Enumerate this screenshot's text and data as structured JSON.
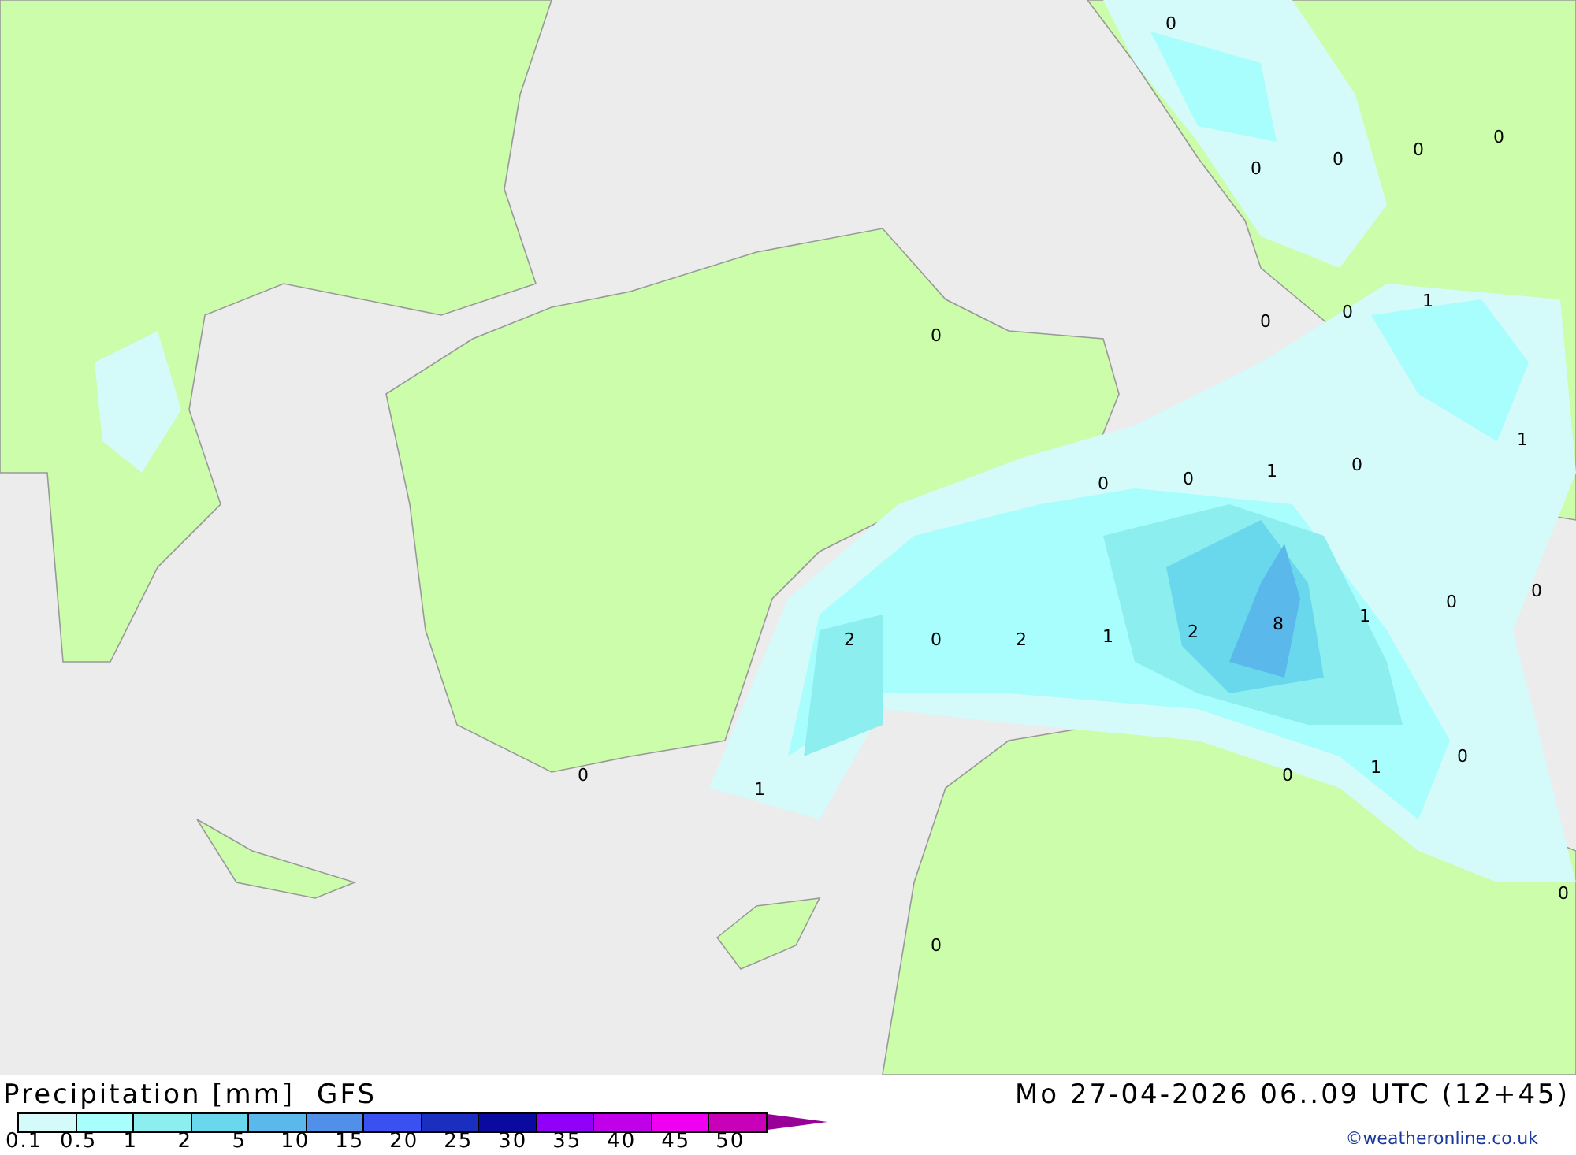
{
  "map": {
    "labels": [
      "0",
      "0",
      "0",
      "0",
      "0",
      "1",
      "0",
      "0",
      "0",
      "1",
      "0",
      "0",
      "1",
      "0",
      "0",
      "0",
      "1",
      "2",
      "0",
      "2",
      "1",
      "2",
      "8",
      "0",
      "1",
      "0",
      "0",
      "1",
      "0",
      "0"
    ]
  },
  "legend": {
    "title": "Precipitation [mm]",
    "model": "GFS",
    "segments": [
      {
        "color": "#d4fafa"
      },
      {
        "color": "#a8fdfd"
      },
      {
        "color": "#8ceeee"
      },
      {
        "color": "#6ad8ec"
      },
      {
        "color": "#5ab8ea"
      },
      {
        "color": "#5090e8"
      },
      {
        "color": "#3a50f0"
      },
      {
        "color": "#1a2ec0"
      },
      {
        "color": "#0a0aa0"
      },
      {
        "color": "#9000f8"
      },
      {
        "color": "#c000e8"
      },
      {
        "color": "#f000f0"
      },
      {
        "color": "#c800b8"
      },
      {
        "color": "#980098",
        "kind": "arrow"
      }
    ],
    "ticks": [
      "0.1",
      "0.5",
      "1",
      "2",
      "5",
      "10",
      "15",
      "20",
      "25",
      "30",
      "35",
      "40",
      "45",
      "50"
    ]
  },
  "valid_time": "Mo 27-04-2026 06..09 UTC (12+45)",
  "credit": "©weatheronline.co.uk"
}
